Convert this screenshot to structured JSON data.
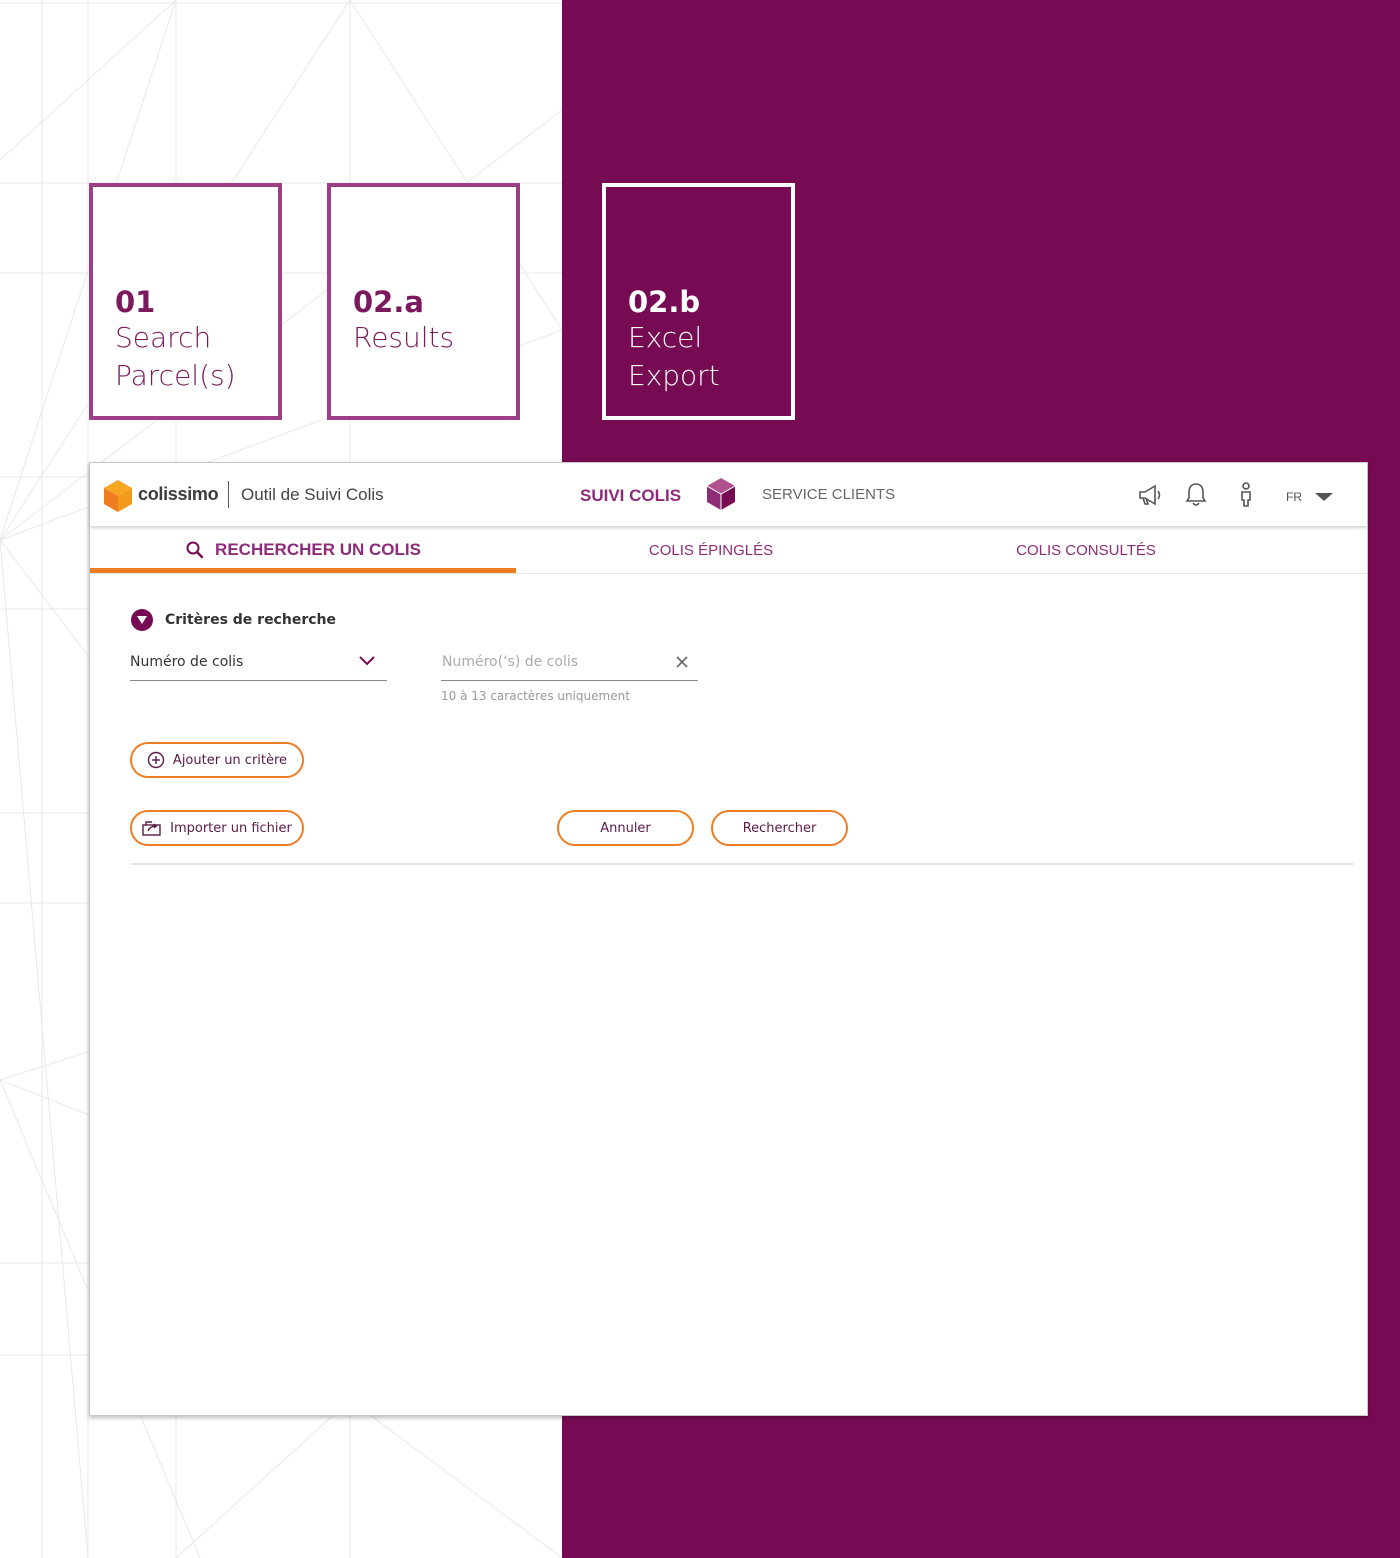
{
  "steps": [
    {
      "num": "01",
      "title": "Search Parcel(s)"
    },
    {
      "num": "02.a",
      "title": "Results"
    },
    {
      "num": "02.b",
      "title": "Excel Export"
    }
  ],
  "header": {
    "logo_text": "colissimo",
    "app_title": "Outil de Suivi Colis",
    "nav_active": "SUIVI COLIS",
    "nav_service": "SERVICE CLIENTS",
    "lang": "FR"
  },
  "tabs": [
    {
      "label": "RECHERCHER UN COLIS"
    },
    {
      "label": "COLIS ÉPINGLÉS"
    },
    {
      "label": "COLIS CONSULTÉS"
    }
  ],
  "form": {
    "criteria_title": "Critères de recherche",
    "select_value": "Numéro de colis",
    "input_placeholder": "Numéro(‘s) de colis",
    "hint": "10 à 13 caractères uniquement",
    "add_criteria": "Ajouter un critère",
    "import_file": "Importer un fichier",
    "cancel": "Annuler",
    "search": "Rechercher"
  },
  "colors": {
    "brand_purple": "#770b53",
    "accent_orange": "#ee7d22",
    "link_purple": "#8e2c7a"
  }
}
